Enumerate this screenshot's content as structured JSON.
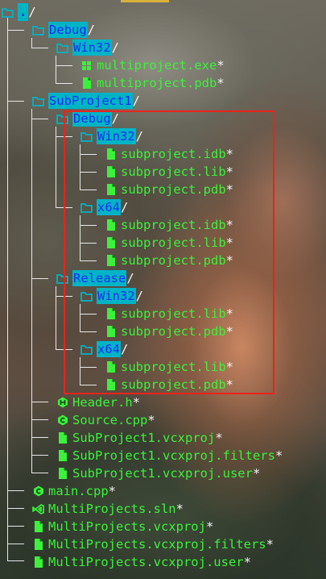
{
  "tree": {
    "root": {
      "name": ".",
      "suffix": "/"
    },
    "entries": [
      {
        "name": "Debug",
        "kind": "dir",
        "suffix": "/",
        "icon": "folder-icon"
      },
      {
        "name": "Win32",
        "kind": "dir",
        "suffix": "/",
        "icon": "folder-icon"
      },
      {
        "name": "multiproject.exe",
        "kind": "file",
        "suffix": "*",
        "icon": "executable-icon"
      },
      {
        "name": "multiproject.pdb",
        "kind": "file",
        "suffix": "*",
        "icon": "file-icon"
      },
      {
        "name": "SubProject1",
        "kind": "dir",
        "suffix": "/",
        "icon": "folder-icon"
      },
      {
        "name": "Debug",
        "kind": "dir",
        "suffix": "/",
        "icon": "folder-icon"
      },
      {
        "name": "Win32",
        "kind": "dir",
        "suffix": "/",
        "icon": "folder-icon"
      },
      {
        "name": "subproject.idb",
        "kind": "file",
        "suffix": "*",
        "icon": "file-icon"
      },
      {
        "name": "subproject.lib",
        "kind": "file",
        "suffix": "*",
        "icon": "file-icon"
      },
      {
        "name": "subproject.pdb",
        "kind": "file",
        "suffix": "*",
        "icon": "file-icon"
      },
      {
        "name": "x64",
        "kind": "dir",
        "suffix": "/",
        "icon": "folder-icon"
      },
      {
        "name": "subproject.idb",
        "kind": "file",
        "suffix": "*",
        "icon": "file-icon"
      },
      {
        "name": "subproject.lib",
        "kind": "file",
        "suffix": "*",
        "icon": "file-icon"
      },
      {
        "name": "subproject.pdb",
        "kind": "file",
        "suffix": "*",
        "icon": "file-icon"
      },
      {
        "name": "Release",
        "kind": "dir",
        "suffix": "/",
        "icon": "folder-icon"
      },
      {
        "name": "Win32",
        "kind": "dir",
        "suffix": "/",
        "icon": "folder-icon"
      },
      {
        "name": "subproject.lib",
        "kind": "file",
        "suffix": "*",
        "icon": "file-icon"
      },
      {
        "name": "subproject.pdb",
        "kind": "file",
        "suffix": "*",
        "icon": "file-icon"
      },
      {
        "name": "x64",
        "kind": "dir",
        "suffix": "/",
        "icon": "folder-icon"
      },
      {
        "name": "subproject.lib",
        "kind": "file",
        "suffix": "*",
        "icon": "file-icon"
      },
      {
        "name": "subproject.pdb",
        "kind": "file",
        "suffix": "*",
        "icon": "file-icon"
      },
      {
        "name": "Header.h",
        "kind": "file",
        "suffix": "*",
        "icon": "header-h-icon"
      },
      {
        "name": "Source.cpp",
        "kind": "file",
        "suffix": "*",
        "icon": "cpp-source-icon"
      },
      {
        "name": "SubProject1.vcxproj",
        "kind": "file",
        "suffix": "*",
        "icon": "file-icon"
      },
      {
        "name": "SubProject1.vcxproj.filters",
        "kind": "file",
        "suffix": "*",
        "icon": "file-icon"
      },
      {
        "name": "SubProject1.vcxproj.user",
        "kind": "file",
        "suffix": "*",
        "icon": "file-icon"
      },
      {
        "name": "main.cpp",
        "kind": "file",
        "suffix": "*",
        "icon": "cpp-source-icon"
      },
      {
        "name": "MultiProjects.sln",
        "kind": "file",
        "suffix": "*",
        "icon": "visual-studio-icon"
      },
      {
        "name": "MultiProjects.vcxproj",
        "kind": "file",
        "suffix": "*",
        "icon": "file-icon"
      },
      {
        "name": "MultiProjects.vcxproj.filters",
        "kind": "file",
        "suffix": "*",
        "icon": "file-icon"
      },
      {
        "name": "MultiProjects.vcxproj.user",
        "kind": "file",
        "suffix": "*",
        "icon": "file-icon"
      }
    ]
  },
  "colors": {
    "dir_highlight": "#00b4c6",
    "dir_text": "#1d2cf0",
    "file_text": "#3af23a",
    "icon_green": "#3af23a",
    "guide_lines": "#e8e8e8",
    "annotation_box": "#e8241c"
  }
}
